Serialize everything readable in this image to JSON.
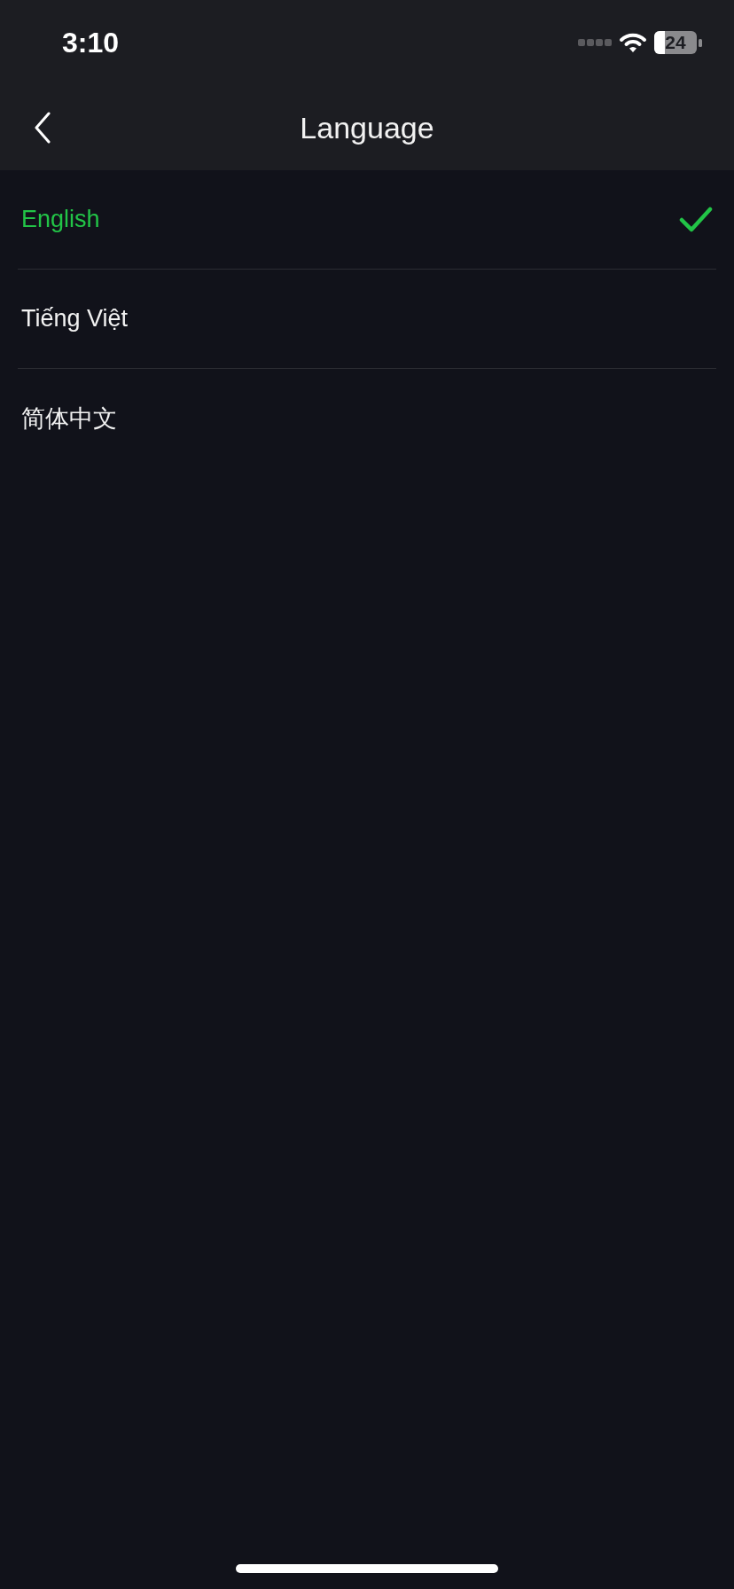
{
  "status_bar": {
    "time": "3:10",
    "battery": "24"
  },
  "header": {
    "title": "Language"
  },
  "languages": [
    {
      "label": "English",
      "selected": true
    },
    {
      "label": "Tiếng Việt",
      "selected": false
    },
    {
      "label": "简体中文",
      "selected": false
    }
  ]
}
